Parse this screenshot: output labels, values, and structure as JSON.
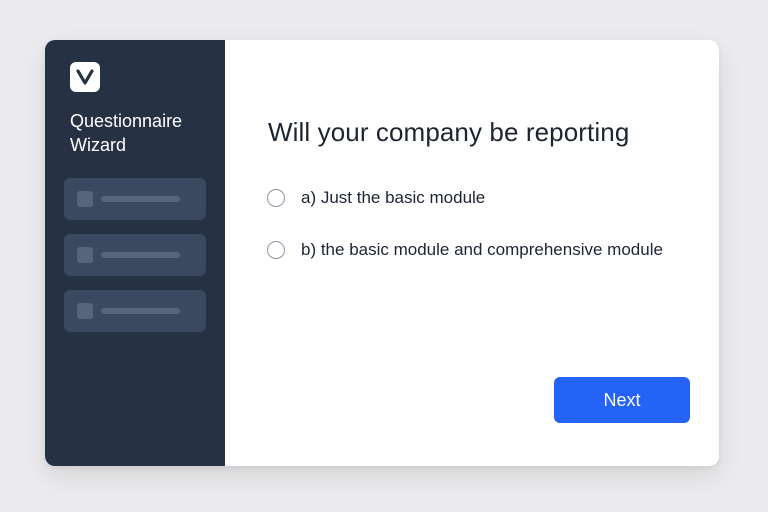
{
  "app": {
    "logo_icon": "v-logo-icon"
  },
  "sidebar": {
    "title_line1": "Questionnaire",
    "title_line2": "Wizard",
    "items": [
      {
        "label": ""
      },
      {
        "label": ""
      },
      {
        "label": ""
      }
    ]
  },
  "main": {
    "question": "Will your company be reporting",
    "options": [
      {
        "label": "a) Just the basic module",
        "selected": false
      },
      {
        "label": "b) the basic module and comprehensive module",
        "selected": false
      }
    ],
    "next_label": "Next"
  },
  "colors": {
    "sidebar_bg": "#263143",
    "nav_item_bg": "#3a4860",
    "accent": "#2463f5",
    "text_dark": "#1d2432"
  }
}
